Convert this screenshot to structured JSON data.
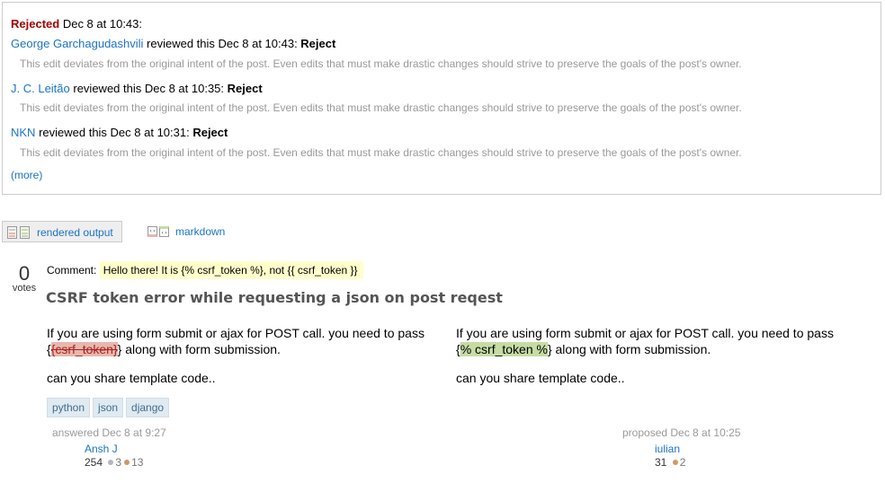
{
  "review": {
    "status": "Rejected",
    "status_time": "Dec 8 at 10:43:",
    "reviews": [
      {
        "reviewer": "George Garchagudashvili",
        "text": " reviewed this Dec 8 at 10:43: ",
        "action": "Reject",
        "comment": "This edit deviates from the original intent of the post. Even edits that must make drastic changes should strive to preserve the goals of the post's owner."
      },
      {
        "reviewer": "J. C. Leitão",
        "text": " reviewed this Dec 8 at 10:35: ",
        "action": "Reject",
        "comment": "This edit deviates from the original intent of the post. Even edits that must make drastic changes should strive to preserve the goals of the post's owner."
      },
      {
        "reviewer": "NKN",
        "text": " reviewed this Dec 8 at 10:31: ",
        "action": "Reject",
        "comment": "This edit deviates from the original intent of the post. Even edits that must make drastic changes should strive to preserve the goals of the post's owner."
      }
    ],
    "more_label": "(more)"
  },
  "view_tabs": {
    "rendered": "rendered output",
    "markdown": "markdown"
  },
  "post": {
    "votes": "0",
    "votes_label": "votes",
    "comment_label": "Comment:",
    "comment_text": "Hello there! It is {% csrf_token %}, not {{ csrf_token }}",
    "title": "CSRF token error while requesting a json on post reqest",
    "original": {
      "line1": "If you are using form submit or ajax for POST call. you need to pass",
      "pre": "{",
      "deleted": "{csrf_token}",
      "post": "} along with form submission.",
      "para2": "can you share template code.."
    },
    "proposed": {
      "line1": "If you are using form submit or ajax for POST call. you need to pass",
      "pre": "{",
      "inserted": "% csrf_token %",
      "post": "} along with form submission.",
      "para2": "can you share template code.."
    },
    "tags": [
      "python",
      "json",
      "django"
    ]
  },
  "answer_sig": {
    "action": "answered Dec 8 at 9:27",
    "user": "Ansh J",
    "reputation": "254",
    "silver": "3",
    "bronze": "13"
  },
  "proposal_sig": {
    "action": "proposed Dec 8 at 10:25",
    "user": "iulian",
    "reputation": "31",
    "bronze": "2"
  }
}
